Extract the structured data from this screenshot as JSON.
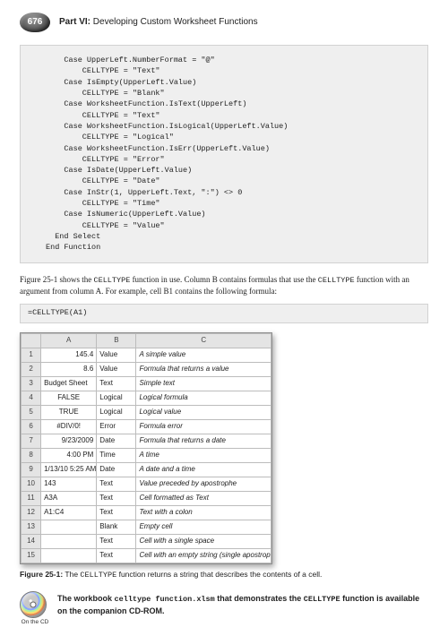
{
  "header": {
    "page_number": "676",
    "part_label": "Part VI:",
    "part_title": "Developing Custom Worksheet Functions"
  },
  "code_block": "    Case UpperLeft.NumberFormat = \"@\"\n        CELLTYPE = \"Text\"\n    Case IsEmpty(UpperLeft.Value)\n        CELLTYPE = \"Blank\"\n    Case WorksheetFunction.IsText(UpperLeft)\n        CELLTYPE = \"Text\"\n    Case WorksheetFunction.IsLogical(UpperLeft.Value)\n        CELLTYPE = \"Logical\"\n    Case WorksheetFunction.IsErr(UpperLeft.Value)\n        CELLTYPE = \"Error\"\n    Case IsDate(UpperLeft.Value)\n        CELLTYPE = \"Date\"\n    Case InStr(1, UpperLeft.Text, \":\") <> 0\n        CELLTYPE = \"Time\"\n    Case IsNumeric(UpperLeft.Value)\n        CELLTYPE = \"Value\"\n  End Select\nEnd Function",
  "para1_a": "Figure 25-1 shows the ",
  "para1_code1": "CELLTYPE",
  "para1_b": " function in use. Column B contains formulas that use the ",
  "para1_code2": "CELLTYPE",
  "para1_c": " function with an argument from column A. For example, cell B1 contains the following formula:",
  "formula": "=CELLTYPE(A1)",
  "sheet": {
    "cols": [
      "A",
      "B",
      "C"
    ],
    "rows": [
      {
        "n": "1",
        "a": "145.4",
        "b": "Value",
        "c": "A simple value",
        "align_a": "right"
      },
      {
        "n": "2",
        "a": "8.6",
        "b": "Value",
        "c": "Formula that returns a value",
        "align_a": "right"
      },
      {
        "n": "3",
        "a": "Budget Sheet",
        "b": "Text",
        "c": "Simple text",
        "align_a": "left"
      },
      {
        "n": "4",
        "a": "FALSE",
        "b": "Logical",
        "c": "Logical formula",
        "align_a": "center"
      },
      {
        "n": "5",
        "a": "TRUE",
        "b": "Logical",
        "c": "Logical value",
        "align_a": "center"
      },
      {
        "n": "6",
        "a": "#DIV/0!",
        "b": "Error",
        "c": "Formula error",
        "align_a": "center"
      },
      {
        "n": "7",
        "a": "9/23/2009",
        "b": "Date",
        "c": "Formula that returns a date",
        "align_a": "right"
      },
      {
        "n": "8",
        "a": "4:00 PM",
        "b": "Time",
        "c": "A time",
        "align_a": "right"
      },
      {
        "n": "9",
        "a": "1/13/10 5:25 AM",
        "b": "Date",
        "c": "A date and a time",
        "align_a": "right"
      },
      {
        "n": "10",
        "a": "143",
        "b": "Text",
        "c": "Value preceded by apostrophe",
        "align_a": "left"
      },
      {
        "n": "11",
        "a": "A3A",
        "b": "Text",
        "c": "Cell formatted as Text",
        "align_a": "left"
      },
      {
        "n": "12",
        "a": "A1:C4",
        "b": "Text",
        "c": "Text with a colon",
        "align_a": "left"
      },
      {
        "n": "13",
        "a": "",
        "b": "Blank",
        "c": "Empty cell",
        "align_a": "left"
      },
      {
        "n": "14",
        "a": "",
        "b": "Text",
        "c": "Cell with a single space",
        "align_a": "left"
      },
      {
        "n": "15",
        "a": "",
        "b": "Text",
        "c": "Cell with an empty string (single apostrophe)",
        "align_a": "left"
      }
    ]
  },
  "caption": {
    "label": "Figure 25-1:",
    "a": " The ",
    "code": "CELLTYPE",
    "b": " function returns a string that describes the contents of a cell."
  },
  "cd": {
    "label": "On the CD",
    "a": "The workbook ",
    "file": "celltype function.xlsm",
    "b": " that demonstrates the ",
    "code": "CELLTYPE",
    "c": " function is available on the companion CD-ROM."
  }
}
